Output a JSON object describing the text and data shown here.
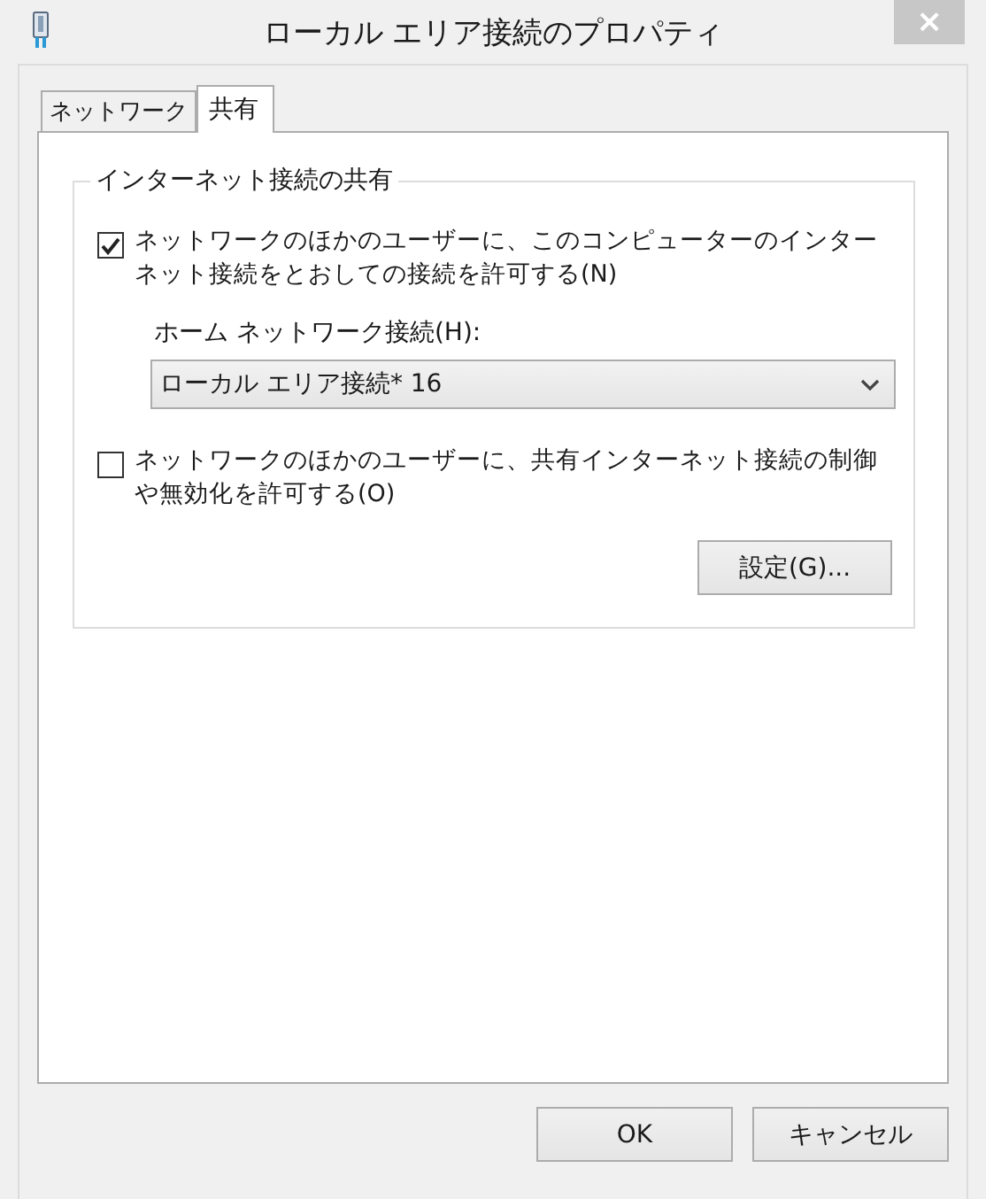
{
  "window": {
    "title": "ローカル エリア接続のプロパティ",
    "close": "×"
  },
  "tabs": [
    {
      "label": "ネットワーク",
      "selected": false
    },
    {
      "label": "共有",
      "selected": true
    }
  ],
  "group": {
    "title": "インターネット接続の共有",
    "options": [
      {
        "kind": "checkbox",
        "label": "ネットワークのほかのユーザーに、このコンピューターのインターネット接続をとおしての接続を許可する(N)",
        "checked": true
      },
      {
        "kind": "select",
        "label": "ホーム ネットワーク接続(H):",
        "value": "ローカル エリア接続* 16"
      },
      {
        "kind": "checkbox",
        "label": "ネットワークのほかのユーザーに、共有インターネット接続の制御や無効化を許可する(O)",
        "checked": false
      },
      {
        "kind": "button",
        "label": "設定(G)..."
      }
    ]
  },
  "buttons": [
    "OK",
    "キャンセル"
  ]
}
